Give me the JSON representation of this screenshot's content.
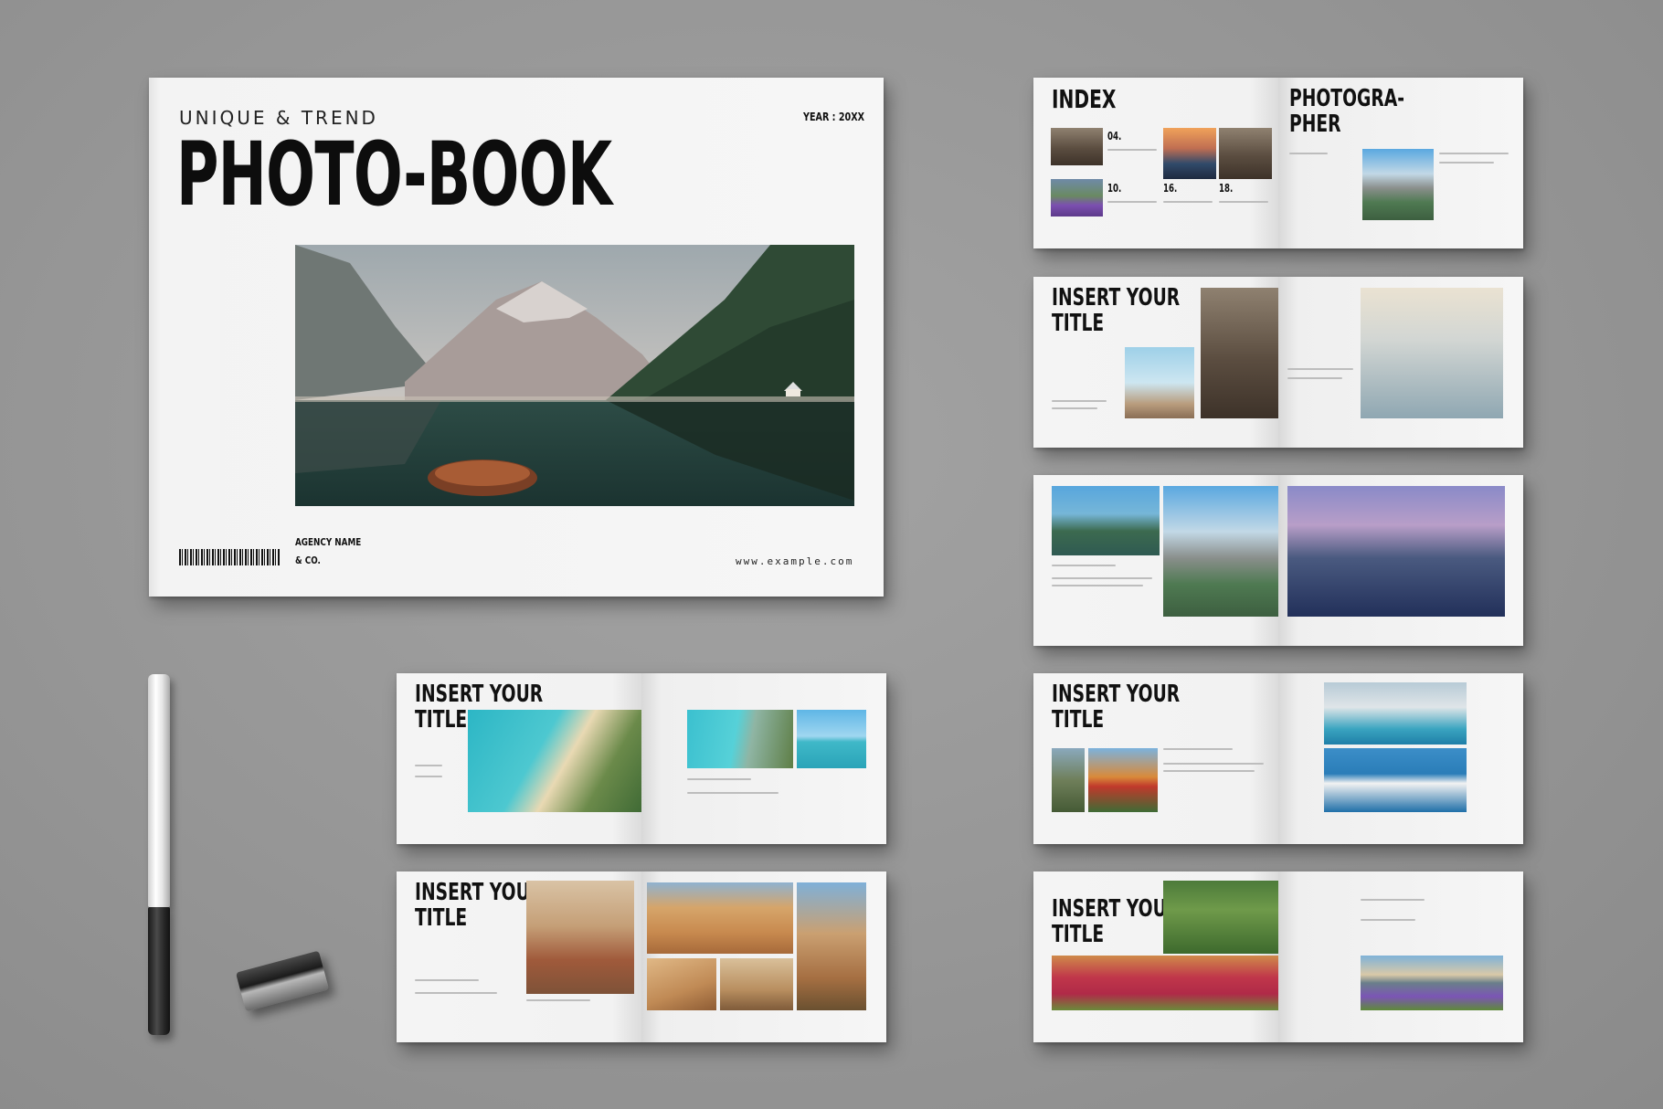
{
  "cover": {
    "tagline": "UNIQUE & TREND",
    "title": "PHOTO-BOOK",
    "year": "YEAR : 20XX",
    "agency_line1": "AGENCY NAME",
    "agency_line2": "& CO.",
    "website": "www.example.com"
  },
  "spreads": {
    "index": {
      "title": "INDEX",
      "numbers": [
        "04.",
        "10.",
        "16.",
        "18."
      ],
      "right_title_line1": "PHOTOGRA-",
      "right_title_line2": "PHER"
    },
    "generic_title_line1": "INSERT YOUR",
    "generic_title_line2": "TITLE"
  },
  "colors": {
    "background": "#969696",
    "page": "#f6f6f6",
    "text": "#111111"
  }
}
